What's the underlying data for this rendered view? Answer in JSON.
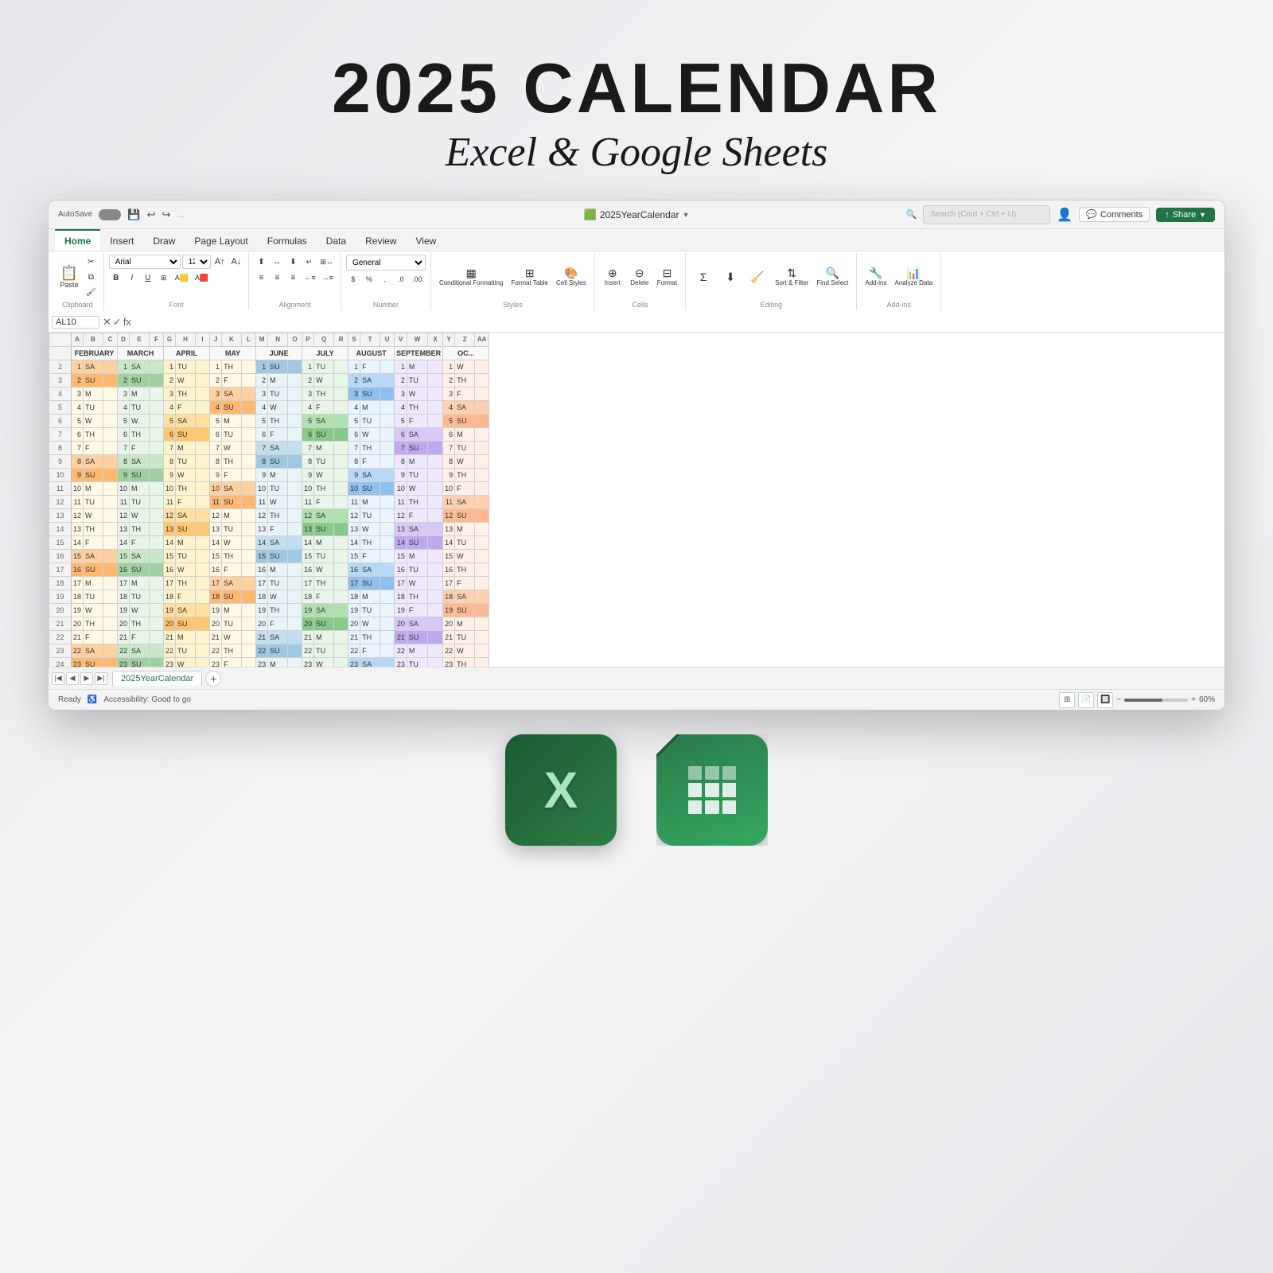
{
  "page": {
    "main_title": "2025 CALENDAR",
    "sub_title": "Excel & Google Sheets"
  },
  "titlebar": {
    "autosave": "AutoSave",
    "file_name": "2025YearCalendar",
    "search_placeholder": "Search (Cmd + Ctrl + U)"
  },
  "ribbon": {
    "tabs": [
      "Home",
      "Insert",
      "Draw",
      "Page Layout",
      "Formulas",
      "Data",
      "Review",
      "View"
    ],
    "active_tab": "Home",
    "font_family": "Arial",
    "font_size": "12",
    "number_format": "General",
    "cell_ref": "AL10",
    "groups": {
      "paste": "Paste",
      "clipboard": "Clipboard",
      "font": "Font",
      "alignment": "Alignment",
      "number": "Number",
      "styles": "Styles",
      "cells": "Cells",
      "editing": "Editing",
      "addins": "Add-ins",
      "analyze": "Analyze Data"
    },
    "buttons": {
      "conditional_formatting": "Conditional Formatting",
      "format_as_table": "Format Table",
      "cell_styles": "Cell Styles",
      "insert": "Insert",
      "delete": "Delete",
      "format": "Format",
      "sort_filter": "Sort & Filter",
      "find_select": "Find Select",
      "add_ins": "Add-ins",
      "analyze_data": "Analyze Data",
      "comments": "Comments",
      "share": "Share"
    }
  },
  "sheet": {
    "tab_name": "2025YearCalendar",
    "months": [
      "FEBRUARY",
      "MARCH",
      "APRIL",
      "MAY",
      "JUNE",
      "JULY",
      "AUGUST",
      "SEPTEMBER",
      "OC"
    ],
    "status": "Ready",
    "accessibility": "Accessibility: Good to go",
    "zoom": "60%"
  },
  "apps": {
    "excel_label": "X",
    "sheets_label": "Sheets"
  }
}
